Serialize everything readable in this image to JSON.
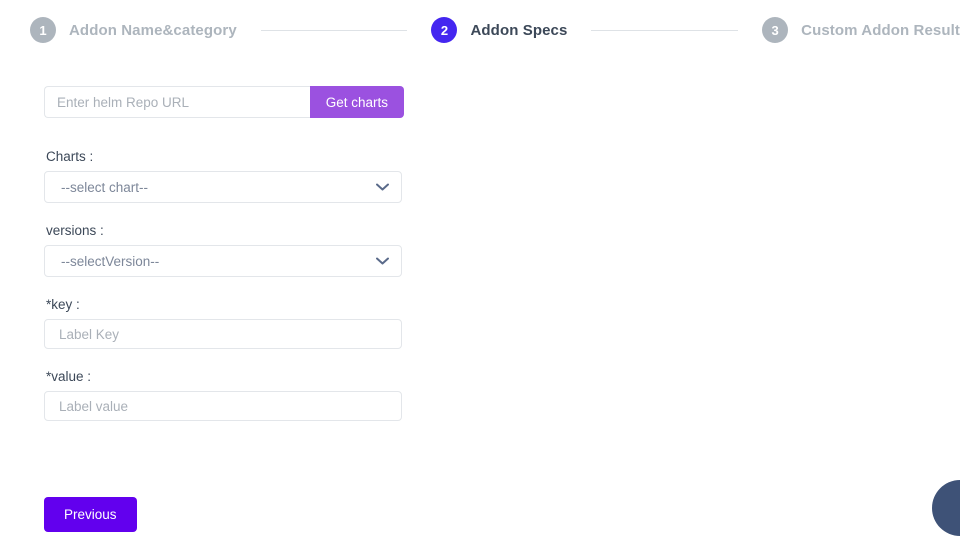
{
  "stepper": {
    "steps": [
      {
        "number": "1",
        "label": "Addon Name&category",
        "state": "inactive"
      },
      {
        "number": "2",
        "label": "Addon Specs",
        "state": "active"
      },
      {
        "number": "3",
        "label": "Custom Addon Result",
        "state": "inactive"
      }
    ]
  },
  "form": {
    "repo": {
      "placeholder": "Enter helm Repo URL",
      "value": "",
      "button_label": "Get charts"
    },
    "charts": {
      "label": "Charts :",
      "selected": "--select chart--"
    },
    "versions": {
      "label": "versions :",
      "selected": "--selectVersion--"
    },
    "key": {
      "label": "*key :",
      "placeholder": "Label Key",
      "value": ""
    },
    "value": {
      "label": "*value :",
      "placeholder": "Label value",
      "value": ""
    },
    "previous_label": "Previous"
  },
  "colors": {
    "active_step": "#4426f0",
    "inactive_step": "#adb5bd",
    "get_charts": "#9b51e0",
    "previous": "#6200ee",
    "chat_bubble": "#3e5277"
  }
}
